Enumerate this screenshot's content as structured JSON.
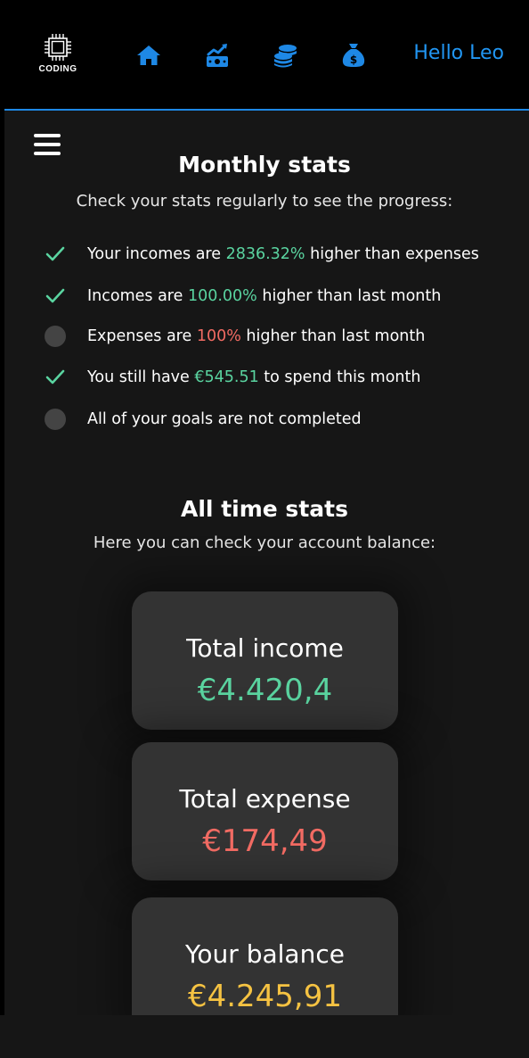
{
  "navbar": {
    "logo_text": "CODING",
    "greeting": "Hello Leo",
    "icons": [
      "home-icon",
      "money-chart-icon",
      "coins-icon",
      "money-bag-icon"
    ],
    "accent": "#2196f3"
  },
  "monthly": {
    "title": "Monthly stats",
    "subtitle": "Check your stats regularly to see the progress:",
    "items": [
      {
        "status": "check",
        "pre": "Your incomes are ",
        "value": "2836.32%",
        "value_color": "green",
        "post": " higher than expenses"
      },
      {
        "status": "check",
        "pre": "Incomes are ",
        "value": "100.00%",
        "value_color": "green",
        "post": " higher than last month"
      },
      {
        "status": "dot",
        "pre": "Expenses are ",
        "value": "100%",
        "value_color": "red",
        "post": " higher than last month"
      },
      {
        "status": "check",
        "pre": "You still have ",
        "value": "€545.51",
        "value_color": "green",
        "post": " to spend this month"
      },
      {
        "status": "dot",
        "pre": "All of your goals are not completed",
        "value": "",
        "value_color": "",
        "post": ""
      }
    ]
  },
  "alltime": {
    "title": "All time stats",
    "subtitle": "Here you can check your account balance:",
    "cards": [
      {
        "label": "Total income",
        "value": "€4.420,4",
        "color": "#5ad4a0"
      },
      {
        "label": "Total expense",
        "value": "€174,49",
        "color": "#f26b63"
      },
      {
        "label": "Your balance",
        "value": "€4.245,91",
        "color": "#f5c242"
      }
    ]
  },
  "colors": {
    "green": "#5ad4a0",
    "red": "#f26b63",
    "yellow": "#f5c242",
    "card_bg": "#333333",
    "page_bg": "#161616"
  }
}
